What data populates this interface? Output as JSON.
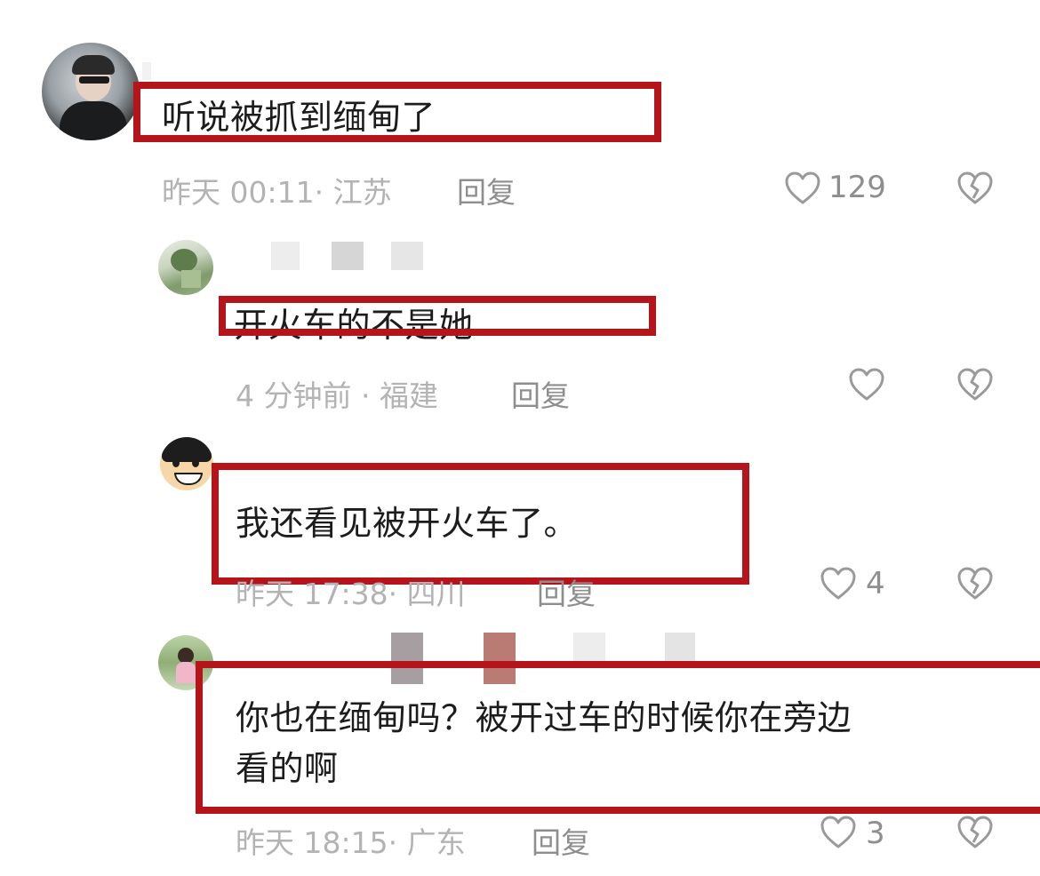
{
  "comments": [
    {
      "text": "听说被抓到缅甸了",
      "meta": "昨天 00:11· 江苏",
      "reply_label": "回复",
      "likes": "129"
    },
    {
      "text": "开火车的不是她",
      "meta": "4 分钟前 · 福建",
      "reply_label": "回复",
      "likes": ""
    },
    {
      "text": "我还看见被开火车了。",
      "meta": "昨天 17:38· 四川",
      "reply_label": "回复",
      "likes": "4"
    },
    {
      "text_line1": "你也在缅甸吗？被开过车的时候你在旁边",
      "text_line2": "看的啊",
      "meta": "昨天 18:15· 广东",
      "reply_label": "回复",
      "likes": "3"
    }
  ],
  "icons": {
    "like": "heart-icon",
    "dislike": "broken-heart-icon"
  },
  "colors": {
    "highlight": "#b5141a",
    "meta_text": "#b3b3b3",
    "icon": "#9a9a9a"
  }
}
